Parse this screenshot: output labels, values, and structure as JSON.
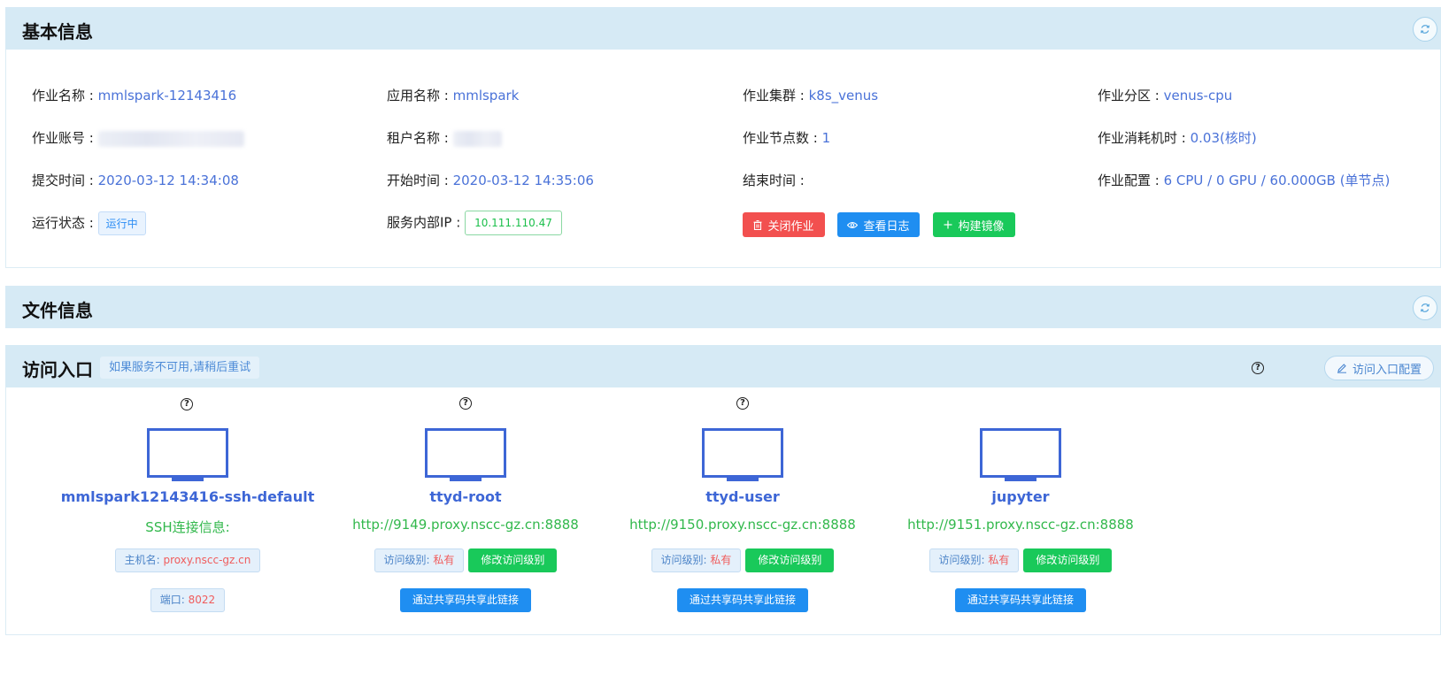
{
  "basic": {
    "title": "基本信息",
    "job_name_label": "作业名称 : ",
    "job_name": "mmlspark-12143416",
    "app_name_label": "应用名称 : ",
    "app_name": "mmlspark",
    "cluster_label": "作业集群 : ",
    "cluster": "k8s_venus",
    "partition_label": "作业分区 : ",
    "partition": "venus-cpu",
    "account_label": "作业账号 : ",
    "tenant_label": "租户名称 : ",
    "nodes_label": "作业节点数 : ",
    "nodes": "1",
    "core_hours_label": "作业消耗机时 : ",
    "core_hours": "0.03(核时)",
    "submit_time_label": "提交时间 : ",
    "submit_time": "2020-03-12 14:34:08",
    "start_time_label": "开始时间 : ",
    "start_time": "2020-03-12 14:35:06",
    "end_time_label": "结束时间 : ",
    "config_label": "作业配置 : ",
    "config": "6 CPU / 0 GPU / 60.000GB (单节点)",
    "status_label": "运行状态 : ",
    "status": "运行中",
    "internal_ip_label": "服务内部IP : ",
    "internal_ip": "10.111.110.47",
    "close_job_btn": "关闭作业",
    "view_log_btn": "查看日志",
    "build_image_btn": "构建镜像"
  },
  "files": {
    "title": "文件信息"
  },
  "access": {
    "title": "访问入口",
    "hint": "如果服务不可用,请稍后重试",
    "config_btn": "访问入口配置",
    "help_glyph": "?",
    "entries": [
      {
        "name": "mmlspark12143416-ssh-default",
        "info": "SSH连接信息:",
        "host_label": "主机名: ",
        "host": "proxy.nscc-gz.cn",
        "port_label": "端口: ",
        "port": "8022"
      },
      {
        "name": "ttyd-root",
        "url": "http://9149.proxy.nscc-gz.cn:8888",
        "level_label": "访问级别: ",
        "level": "私有",
        "modify_btn": "修改访问级别",
        "share_btn": "通过共享码共享此链接"
      },
      {
        "name": "ttyd-user",
        "url": "http://9150.proxy.nscc-gz.cn:8888",
        "level_label": "访问级别: ",
        "level": "私有",
        "modify_btn": "修改访问级别",
        "share_btn": "通过共享码共享此链接"
      },
      {
        "name": "jupyter",
        "url": "http://9151.proxy.nscc-gz.cn:8888",
        "level_label": "访问级别: ",
        "level": "私有",
        "modify_btn": "修改访问级别",
        "share_btn": "通过共享码共享此链接"
      }
    ]
  },
  "colors": {
    "accent": "#4a72d8",
    "header_bg": "#d6eaf5",
    "success": "#19c95a",
    "danger": "#f2504f",
    "primary": "#1f8ef1"
  }
}
